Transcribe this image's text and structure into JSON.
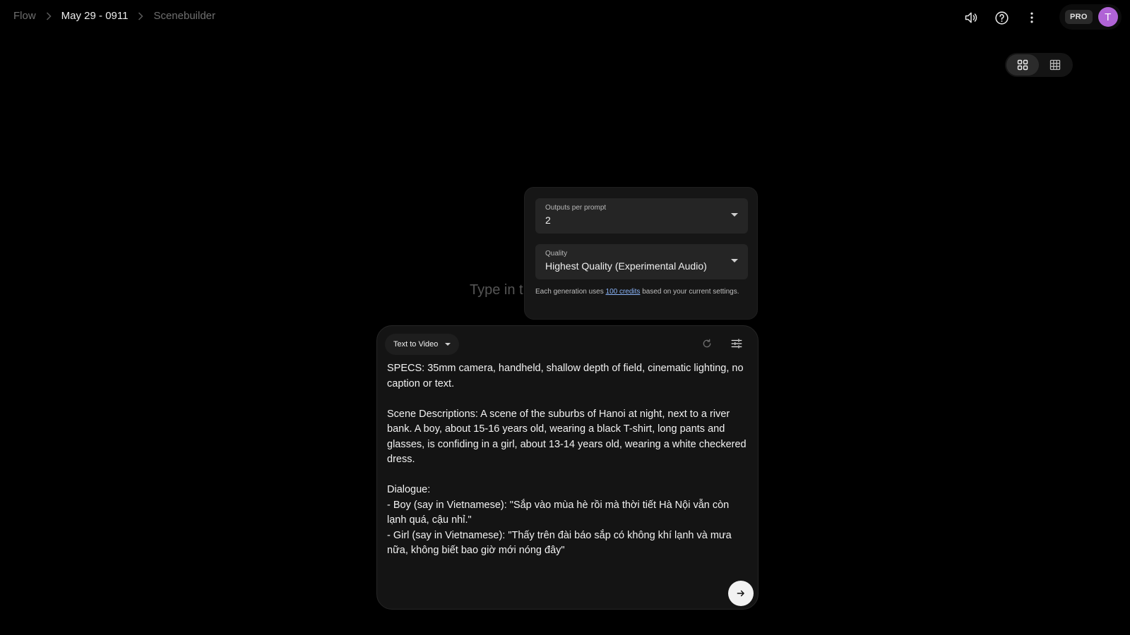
{
  "breadcrumb": {
    "items": [
      "Flow",
      "May 29 - 0911",
      "Scenebuilder"
    ]
  },
  "header": {
    "icons": [
      "volume-icon",
      "help-icon",
      "more-vert-icon"
    ],
    "badge": "PRO",
    "avatar_initial": "T"
  },
  "view_toggle": {
    "options": [
      "grid-view-icon",
      "list-grid-view-icon"
    ],
    "active": 0
  },
  "background_hint": "Type in t",
  "settings": {
    "outputs_label": "Outputs per prompt",
    "outputs_value": "2",
    "quality_label": "Quality",
    "quality_value": "Highest Quality (Experimental Audio)",
    "note_prefix": "Each generation uses ",
    "note_link": "100 credits",
    "note_suffix": " based on your current settings."
  },
  "prompt": {
    "mode": "Text to Video",
    "text": "SPECS: 35mm camera, handheld, shallow depth of field, cinematic lighting, no caption or text.\n\nScene Descriptions: A scene of the suburbs of Hanoi at night, next to a river bank. A boy, about 15-16 years old, wearing a black T-shirt, long pants and glasses, is confiding in a girl, about 13-14 years old, wearing a white checkered dress.\n\nDialogue:\n- Boy (say in Vietnamese): \"Sắp vào mùa hè rồi mà thời tiết Hà Nội vẫn còn lạnh quá, cậu nhỉ.\"\n- Girl (say in Vietnamese): \"Thấy trên đài báo sắp có không khí lạnh và mưa nữa, không biết bao giờ mới nóng đây\""
  },
  "colors": {
    "background": "#000000",
    "avatar": "#b063d6",
    "link": "#8ab4f8"
  }
}
